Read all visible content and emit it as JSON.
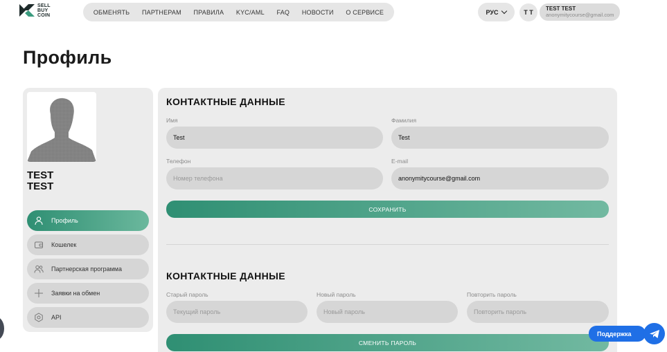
{
  "logo": {
    "line1": "SELL",
    "line2": "BUY",
    "line3": "COIN",
    "mark_icon": "sellbuycoin-logo-icon"
  },
  "nav": {
    "items": [
      "ОБМЕНЯТЬ",
      "ПАРТНЕРАМ",
      "ПРАВИЛА",
      "KYC/AML",
      "FAQ",
      "НОВОСТИ",
      "О СЕРВИСЕ"
    ]
  },
  "lang": {
    "label": "РУС",
    "icon": "chevron-down-icon"
  },
  "user": {
    "initials": "T T",
    "name": "TEST TEST",
    "email": "anonymitycourse@gmail.com"
  },
  "page": {
    "title": "Профиль"
  },
  "profile": {
    "first": "TEST",
    "last": "TEST",
    "photo_icon": "avatar-placeholder-icon"
  },
  "sidebar": {
    "items": [
      {
        "label": "Профиль",
        "icon": "user-icon",
        "active": true
      },
      {
        "label": "Кошелек",
        "icon": "wallet-icon",
        "active": false
      },
      {
        "label": "Партнерская программа",
        "icon": "users-icon",
        "active": false
      },
      {
        "label": "Заявки на обмен",
        "icon": "exchange-icon",
        "active": false
      },
      {
        "label": "API",
        "icon": "gear-icon",
        "active": false
      }
    ]
  },
  "contacts": {
    "title": "КОНТАКТНЫЕ ДАННЫЕ",
    "first_name_label": "Имя",
    "first_name_value": "Test",
    "last_name_label": "Фамилия",
    "last_name_value": "Test",
    "phone_label": "Телефон",
    "phone_placeholder": "Номер телефона",
    "email_label": "E-mail",
    "email_value": "anonymitycourse@gmail.com",
    "save_label": "СОХРАНИТЬ"
  },
  "password": {
    "title": "КОНТАКТНЫЕ ДАННЫЕ",
    "old_label": "Старый пароль",
    "old_placeholder": "Текущий пароль",
    "new_label": "Новый пароль",
    "new_placeholder": "Новый пароль",
    "repeat_label": "Повторить пароль",
    "repeat_placeholder": "Повторить пароль",
    "change_label": "СМЕНИТЬ ПАРОЛЬ"
  },
  "support": {
    "label": "Поддержка",
    "icon": "telegram-icon"
  },
  "colors": {
    "accent_start": "#2f8f73",
    "accent_end": "#72b9a1",
    "support": "#1f6fe6"
  }
}
